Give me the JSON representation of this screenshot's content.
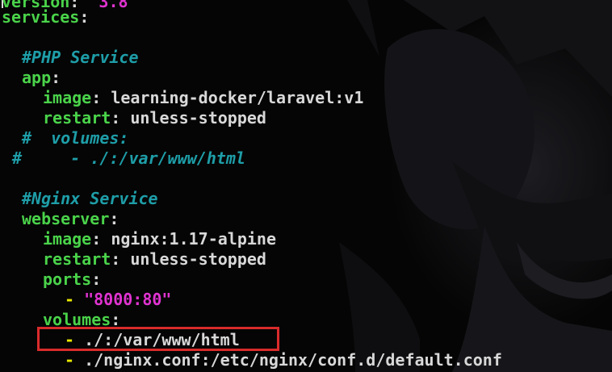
{
  "colors": {
    "key": "#4ad34a",
    "value": "#d8d8d8",
    "string": "#e033d0",
    "list_dash": "#e8e800",
    "comment": "#1e9ea8",
    "highlight_border": "#d92b2b",
    "background": "#050505"
  },
  "lines": {
    "l0": {
      "key": "version",
      "colon": ":",
      "value": "\"3.8\""
    },
    "l1": {
      "key": "services",
      "colon": ":"
    },
    "l2": {
      "comment": "#PHP Service"
    },
    "l3": {
      "key": "app",
      "colon": ":"
    },
    "l4": {
      "key": "image",
      "colon": ":",
      "value": "learning-docker/laravel:v1"
    },
    "l5": {
      "key": "restart",
      "colon": ":",
      "value": "unless-stopped"
    },
    "l6": {
      "comment": "#  volumes:"
    },
    "l7": {
      "comment": "#     - ./:/var/www/html"
    },
    "l8": {
      "comment": "#Nginx Service"
    },
    "l9": {
      "key": "webserver",
      "colon": ":"
    },
    "l10": {
      "key": "image",
      "colon": ":",
      "value": "nginx:1.17-alpine"
    },
    "l11": {
      "key": "restart",
      "colon": ":",
      "value": "unless-stopped"
    },
    "l12": {
      "key": "ports",
      "colon": ":"
    },
    "l13": {
      "dash": "-",
      "value": "\"8000:80\""
    },
    "l14": {
      "key": "volumes",
      "colon": ":"
    },
    "l15": {
      "dash": "-",
      "value": "./:/var/www/html"
    },
    "l16": {
      "dash": "-",
      "value": "./nginx.conf:/etc/nginx/conf.d/default.conf"
    }
  }
}
